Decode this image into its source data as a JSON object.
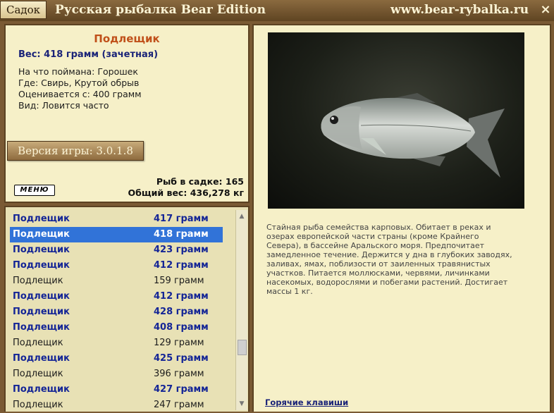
{
  "titlebar": {
    "sadok_label": "Садок",
    "app_title": "Русская рыбалка Bear Edition",
    "site_url": "www.bear-rybalka.ru",
    "close_label": "×"
  },
  "info": {
    "fish_name": "Подлещик",
    "weight_line": "Вес: 418 грамм (зачетная)",
    "caught_on": "На что поймана: Горошек",
    "location": "Где: Свирь, Крутой обрыв",
    "rated_from": "Оценивается с: 400 грамм",
    "species": "Вид: Ловится часто",
    "version_label": "Версия игры: 3.0.1.8",
    "menu_logo": "МЕНЮ",
    "fish_count": "Рыб в садке: 165",
    "total_weight": "Общий вес: 436,278 кг"
  },
  "catch_list": [
    {
      "name": "Подлещик",
      "weight": "417 грамм",
      "kind": "trophy"
    },
    {
      "name": "Подлещик",
      "weight": "418 грамм",
      "kind": "selected"
    },
    {
      "name": "Подлещик",
      "weight": "423 грамм",
      "kind": "trophy"
    },
    {
      "name": "Подлещик",
      "weight": "412 грамм",
      "kind": "trophy"
    },
    {
      "name": "Подлещик",
      "weight": "159 грамм",
      "kind": "normal"
    },
    {
      "name": "Подлещик",
      "weight": "412 грамм",
      "kind": "trophy"
    },
    {
      "name": "Подлещик",
      "weight": "428 грамм",
      "kind": "trophy"
    },
    {
      "name": "Подлещик",
      "weight": "408 грамм",
      "kind": "trophy"
    },
    {
      "name": "Подлещик",
      "weight": "129 грамм",
      "kind": "normal"
    },
    {
      "name": "Подлещик",
      "weight": "425 грамм",
      "kind": "trophy"
    },
    {
      "name": "Подлещик",
      "weight": "396 грамм",
      "kind": "normal"
    },
    {
      "name": "Подлещик",
      "weight": "427 грамм",
      "kind": "trophy"
    },
    {
      "name": "Подлещик",
      "weight": "247 грамм",
      "kind": "normal"
    }
  ],
  "description": "Стайная рыба семейства карповых. Обитает в реках и озерах европейской части страны (кроме Крайнего Севера), в бассейне Аральского моря. Предпочитает замедленное течение. Держится у дна в глубоких заводях, заливах, ямах, поблизости от заиленных травянистых участков. Питается моллюсками, червями, личинками насекомых, водорослями и побегами растений. Достигает массы 1 кг.",
  "hotkeys_label": "Горячие клавиши",
  "colors": {
    "accent_title": "#c0501a",
    "trophy_text": "#142596",
    "selection": "#3173d8",
    "panel_bg": "#f6f0c8",
    "frame": "#5b4222"
  }
}
